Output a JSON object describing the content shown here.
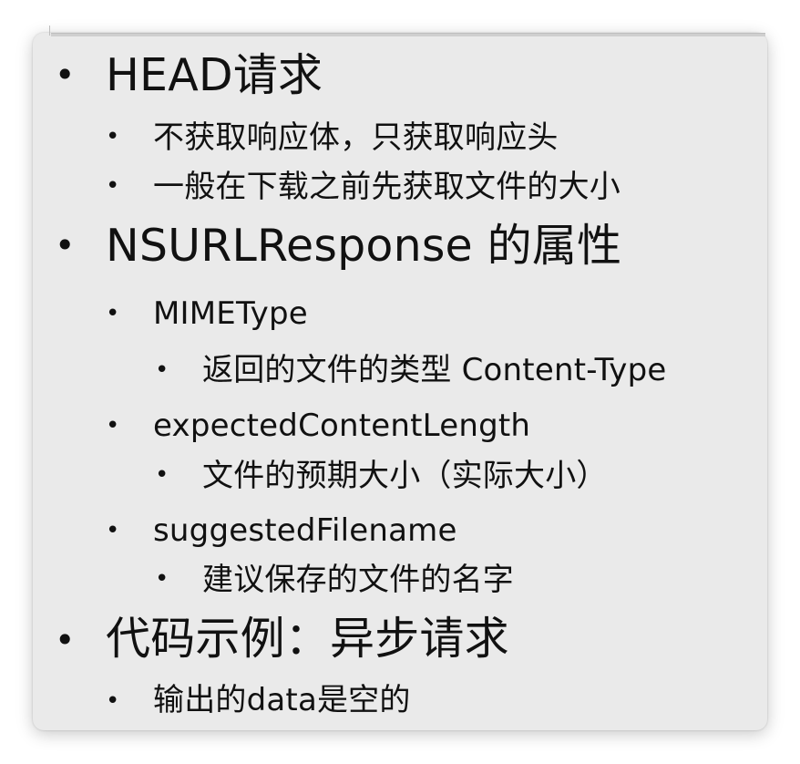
{
  "slide": {
    "items": [
      {
        "label": "HEAD请求",
        "children": [
          {
            "label": "不获取响应体，只获取响应头"
          },
          {
            "label": "一般在下载之前先获取文件的大小"
          }
        ]
      },
      {
        "label": "NSURLResponse 的属性",
        "children": [
          {
            "label": "MIMEType",
            "children": [
              {
                "label": "返回的文件的类型 Content-Type"
              }
            ]
          },
          {
            "label": "expectedContentLength",
            "children": [
              {
                "label": "文件的预期大小（实际大小）"
              }
            ]
          },
          {
            "label": "suggestedFilename",
            "children": [
              {
                "label": "建议保存的文件的名字"
              }
            ]
          }
        ]
      },
      {
        "label": "代码示例：异步请求",
        "children": [
          {
            "label": "输出的data是空的"
          }
        ]
      }
    ],
    "bullet_symbol": "•"
  }
}
